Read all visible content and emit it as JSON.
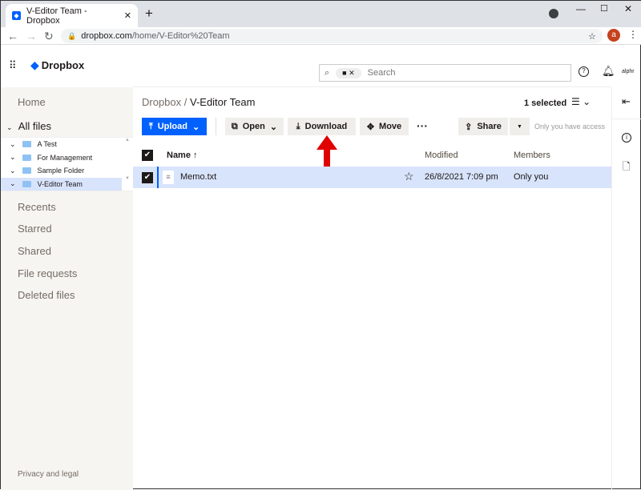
{
  "browser": {
    "tab_title": "V-Editor Team - Dropbox",
    "url_domain": "dropbox.com",
    "url_path": "/home/V-Editor%20Team",
    "profile_initial": "a"
  },
  "header": {
    "logo": "Dropbox",
    "search_placeholder": "Search",
    "account": "alphr"
  },
  "sidebar": {
    "home": "Home",
    "all_files": "All files",
    "tree": [
      {
        "label": "A Test"
      },
      {
        "label": "For Management"
      },
      {
        "label": "Sample Folder"
      },
      {
        "label": "V-Editor Team",
        "selected": true
      }
    ],
    "links": [
      "Recents",
      "Starred",
      "Shared",
      "File requests",
      "Deleted files"
    ],
    "footer": "Privacy and legal"
  },
  "breadcrumb": {
    "root": "Dropbox",
    "current": "V-Editor Team"
  },
  "selection": {
    "count_label": "1 selected"
  },
  "toolbar": {
    "upload": "Upload",
    "open": "Open",
    "download": "Download",
    "move": "Move",
    "share": "Share",
    "access_note": "Only you have access"
  },
  "table": {
    "headers": {
      "name": "Name",
      "modified": "Modified",
      "members": "Members"
    },
    "rows": [
      {
        "name": "Memo.txt",
        "modified": "26/8/2021 7:09 pm",
        "members": "Only you",
        "selected": true
      }
    ]
  },
  "colors": {
    "accent": "#0061fe",
    "selected_row": "#d8e4fb",
    "annotation_arrow": "#e00000"
  }
}
